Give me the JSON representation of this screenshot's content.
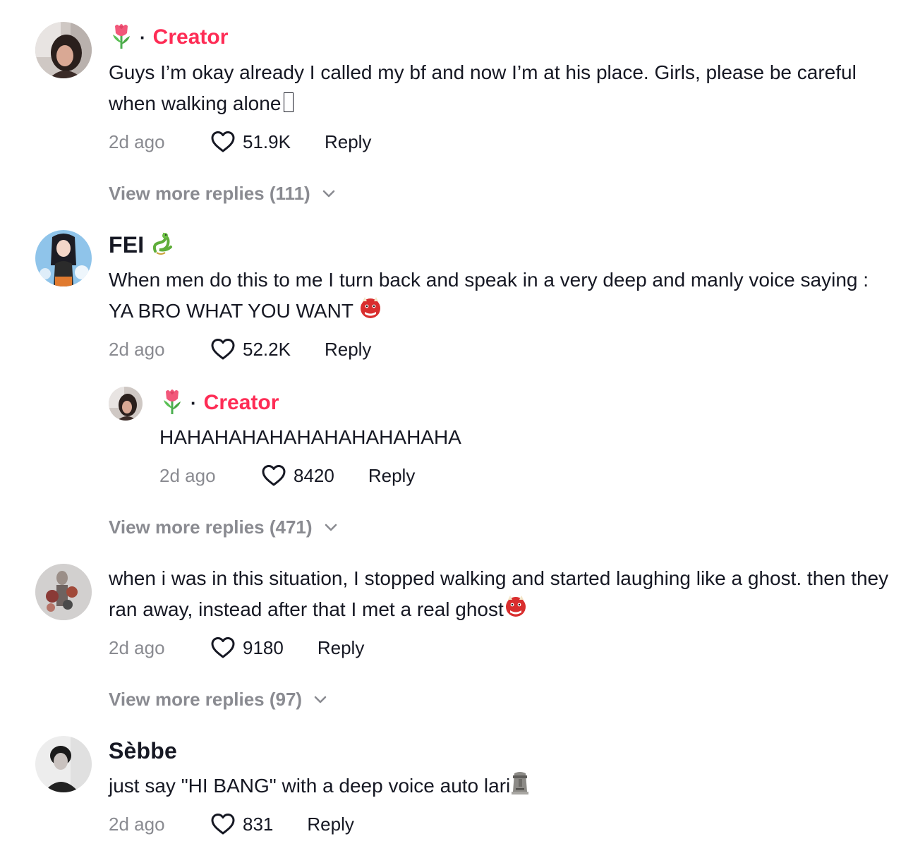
{
  "comments": [
    {
      "username": "",
      "creator_label": "Creator",
      "badge_icon": "tulip-emoji",
      "text": "Guys I’m okay already I called my bf and now I’m at his place. Girls, please be careful when walking alone",
      "time": "2d ago",
      "likes": "51.9K",
      "reply": "Reply",
      "view_more": "View more replies (111)"
    },
    {
      "username": "FEI",
      "badge_icon": "dragon-emoji",
      "text": "When men do this to me I turn back and speak in a very deep and manly voice saying : YA BRO WHAT YOU WANT",
      "trailing_icon": "ogre-emoji",
      "time": "2d ago",
      "likes": "52.2K",
      "reply": "Reply",
      "view_more": "View more replies (471)",
      "replies": [
        {
          "creator_label": "Creator",
          "badge_icon": "tulip-emoji",
          "text": "HAHAHAHAHAHAHAHAHAHAHA",
          "time": "2d ago",
          "likes": "8420",
          "reply": "Reply"
        }
      ]
    },
    {
      "username": "",
      "text": "when i was in this situation, I stopped walking and started laughing like a ghost. then they ran away, instead after that I met a real ghost",
      "trailing_icon": "ogre-emoji",
      "time": "2d ago",
      "likes": "9180",
      "reply": "Reply",
      "view_more": "View more replies (97)"
    },
    {
      "username": "Sèbbe",
      "text": "just say \"HI BANG\" with a deep voice auto lari",
      "trailing_icon": "moai-emoji",
      "time": "2d ago",
      "likes": "831",
      "reply": "Reply"
    }
  ],
  "colors": {
    "creator": "#fe2c55",
    "muted": "#8a8b91",
    "text": "#161823"
  }
}
